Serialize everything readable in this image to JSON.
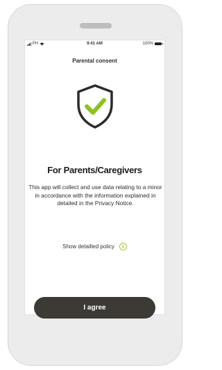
{
  "status_bar": {
    "carrier": "PH",
    "time": "9:41 AM",
    "battery_level": "100%",
    "icons": [
      "signal-icon",
      "wifi-icon",
      "battery-icon"
    ]
  },
  "screen": {
    "title": "Parental consent",
    "illustration": "shield-check-icon",
    "heading": "For Parents/Caregivers",
    "body": "This app will collect and use data relating to a minor in accordance with the information explained in detailed in the Privacy Notice.",
    "policy_link": "Show detailled policy",
    "policy_info_icon": "info-icon",
    "agree_button": "I agree"
  },
  "colors": {
    "accent_green": "#8dc21f",
    "info_icon": "#a6c636",
    "button_bg": "#3d3a36",
    "phone_frame": "#ececec"
  }
}
